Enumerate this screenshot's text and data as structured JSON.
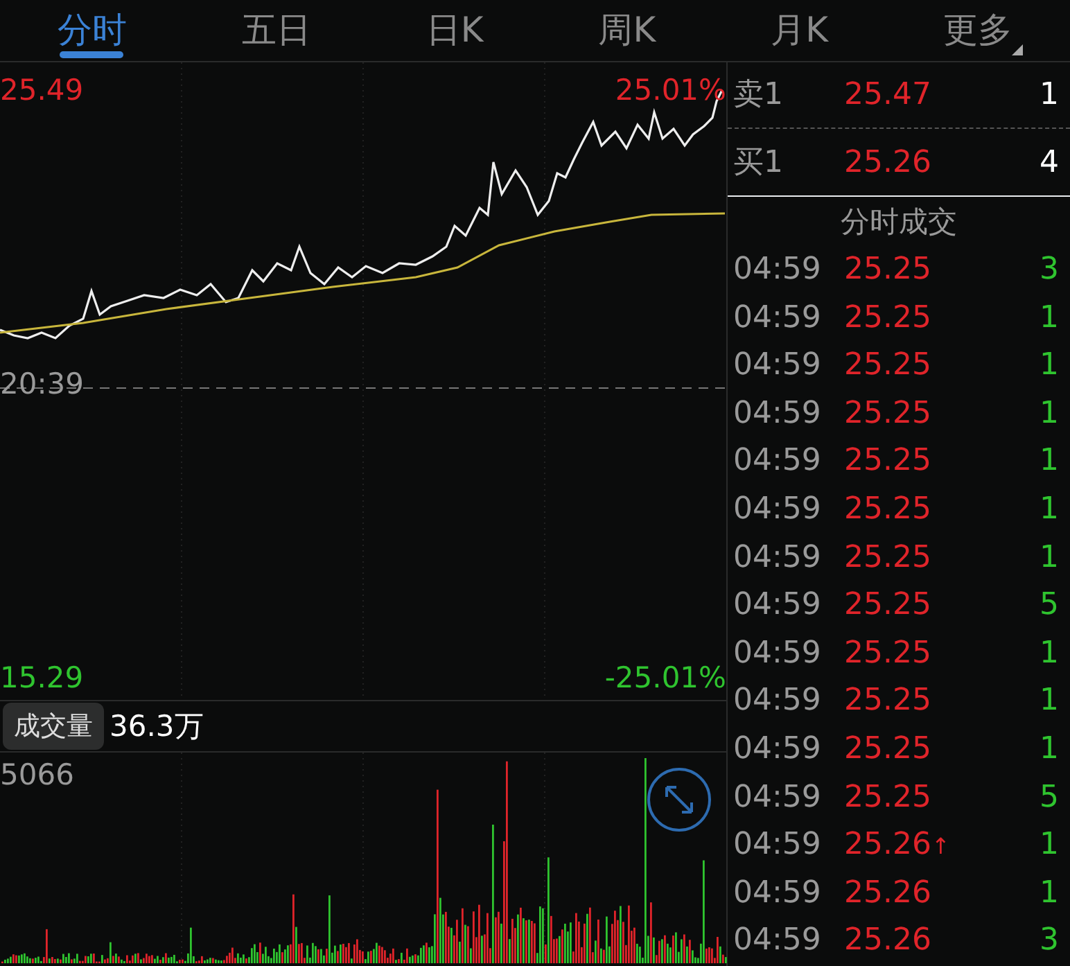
{
  "tabs": [
    {
      "label": "分时",
      "selected": true,
      "kind": "plain"
    },
    {
      "label": "五日",
      "selected": false,
      "kind": "plain"
    },
    {
      "label": "日K",
      "selected": false,
      "kind": "plain"
    },
    {
      "label": "周K",
      "selected": false,
      "kind": "plain"
    },
    {
      "label": "月K",
      "selected": false,
      "kind": "plain"
    },
    {
      "label": "更多",
      "selected": false,
      "kind": "dropdown"
    }
  ],
  "price_chart": {
    "high": "25.49",
    "high_pct": "25.01%",
    "mid": "20:39",
    "low": "15.29",
    "low_pct": "-25.01%"
  },
  "volume": {
    "button": "成交量",
    "total": "36.3万",
    "max": "5066"
  },
  "order_book": [
    {
      "label": "卖1",
      "price": "25.47",
      "qty": "1"
    },
    {
      "label": "买1",
      "price": "25.26",
      "qty": "4"
    }
  ],
  "trades_title": "分时成交",
  "trades": [
    {
      "time": "04:59",
      "price": "25.25",
      "qty": "3"
    },
    {
      "time": "04:59",
      "price": "25.25",
      "qty": "1"
    },
    {
      "time": "04:59",
      "price": "25.25",
      "qty": "1"
    },
    {
      "time": "04:59",
      "price": "25.25",
      "qty": "1"
    },
    {
      "time": "04:59",
      "price": "25.25",
      "qty": "1"
    },
    {
      "time": "04:59",
      "price": "25.25",
      "qty": "1"
    },
    {
      "time": "04:59",
      "price": "25.25",
      "qty": "1"
    },
    {
      "time": "04:59",
      "price": "25.25",
      "qty": "5"
    },
    {
      "time": "04:59",
      "price": "25.25",
      "qty": "1"
    },
    {
      "time": "04:59",
      "price": "25.25",
      "qty": "1"
    },
    {
      "time": "04:59",
      "price": "25.25",
      "qty": "1"
    },
    {
      "time": "04:59",
      "price": "25.25",
      "qty": "5"
    },
    {
      "time": "04:59",
      "price": "25.26",
      "arrow": "↑",
      "qty": "1"
    },
    {
      "time": "04:59",
      "price": "25.26",
      "qty": "1"
    },
    {
      "time": "04:59",
      "price": "25.26",
      "qty": "3"
    }
  ]
}
